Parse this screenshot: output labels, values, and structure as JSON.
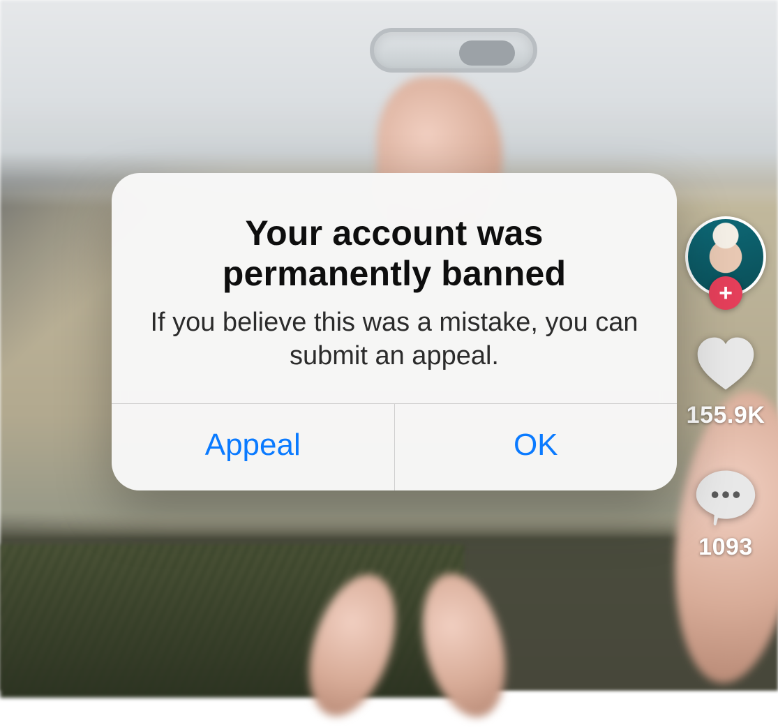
{
  "modal": {
    "title": "Your account was permanently banned",
    "message": "If you believe this was a mistake, you can submit an appeal.",
    "appeal_label": "Appeal",
    "ok_label": "OK"
  },
  "rail": {
    "follow_badge_glyph": "+",
    "like_count": "155.9K",
    "comment_count": "1093"
  },
  "colors": {
    "ios_blue": "#0a7aff",
    "follow_red": "#e43f5a"
  }
}
